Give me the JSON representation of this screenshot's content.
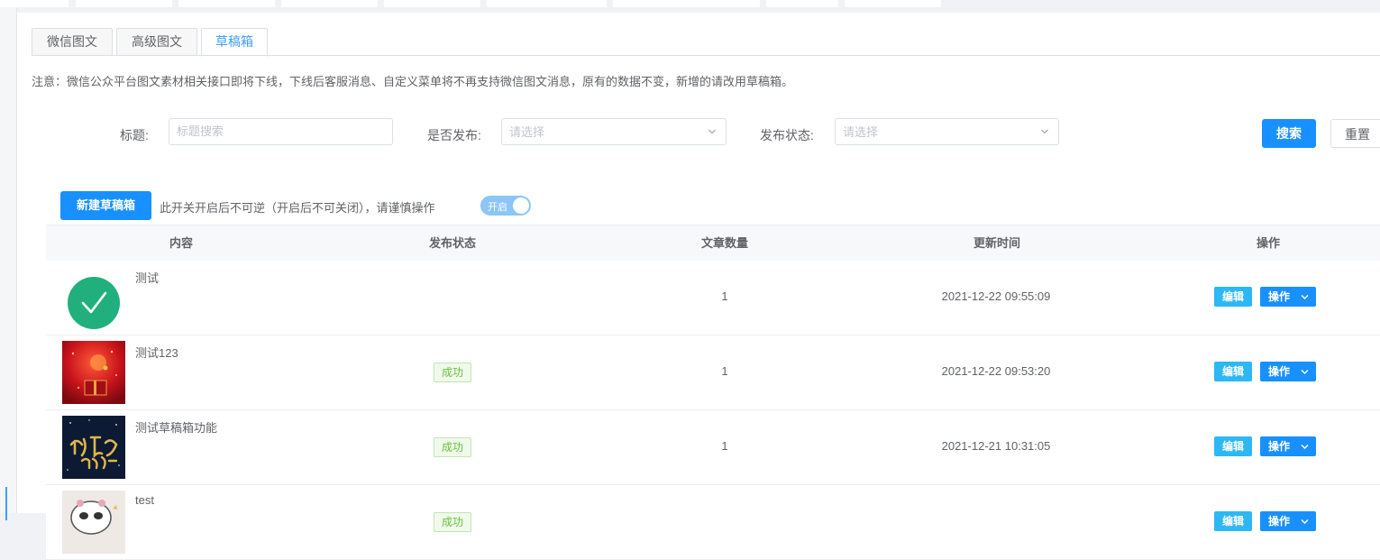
{
  "tabs": [
    {
      "label": "微信图文"
    },
    {
      "label": "高级图文"
    },
    {
      "label": "草稿箱"
    }
  ],
  "notice": "注意：微信公众平台图文素材相关接口即将下线，下线后客服消息、自定义菜单将不再支持微信图文消息，原有的数据不变，新增的请改用草稿箱。",
  "filters": {
    "title_label": "标题:",
    "title_placeholder": "标题搜索",
    "published_label": "是否发布:",
    "published_placeholder": "请选择",
    "status_label": "发布状态:",
    "status_placeholder": "请选择",
    "search_label": "搜索",
    "reset_label": "重置"
  },
  "toolbar": {
    "new_draft_label": "新建草稿箱",
    "hint": "此开关开启后不可逆（开启后不可关闭），请谨慎操作",
    "switch_text": "开启"
  },
  "table": {
    "columns": [
      "内容",
      "发布状态",
      "文章数量",
      "更新时间",
      "操作"
    ],
    "edit_label": "编辑",
    "ops_label": "操作",
    "rows": [
      {
        "title": "测试",
        "thumb": "green-check-icon",
        "status": "",
        "count": "1",
        "updated": "2021-12-22 09:55:09"
      },
      {
        "title": "测试123",
        "thumb": "red-gift-image",
        "status": "成功",
        "count": "1",
        "updated": "2021-12-22 09:53:20"
      },
      {
        "title": "测试草稿箱功能",
        "thumb": "dark-calligraphy-image",
        "status": "成功",
        "count": "1",
        "updated": "2021-12-21 10:31:05"
      },
      {
        "title": "test",
        "thumb": "cartoon-avatar-image",
        "status": "成功",
        "count": "",
        "updated": ""
      }
    ]
  },
  "colors": {
    "primary": "#1890ff",
    "edit": "#2db7f5",
    "success": "#67c23a",
    "switch_on_disabled": "#8cc5f7"
  }
}
